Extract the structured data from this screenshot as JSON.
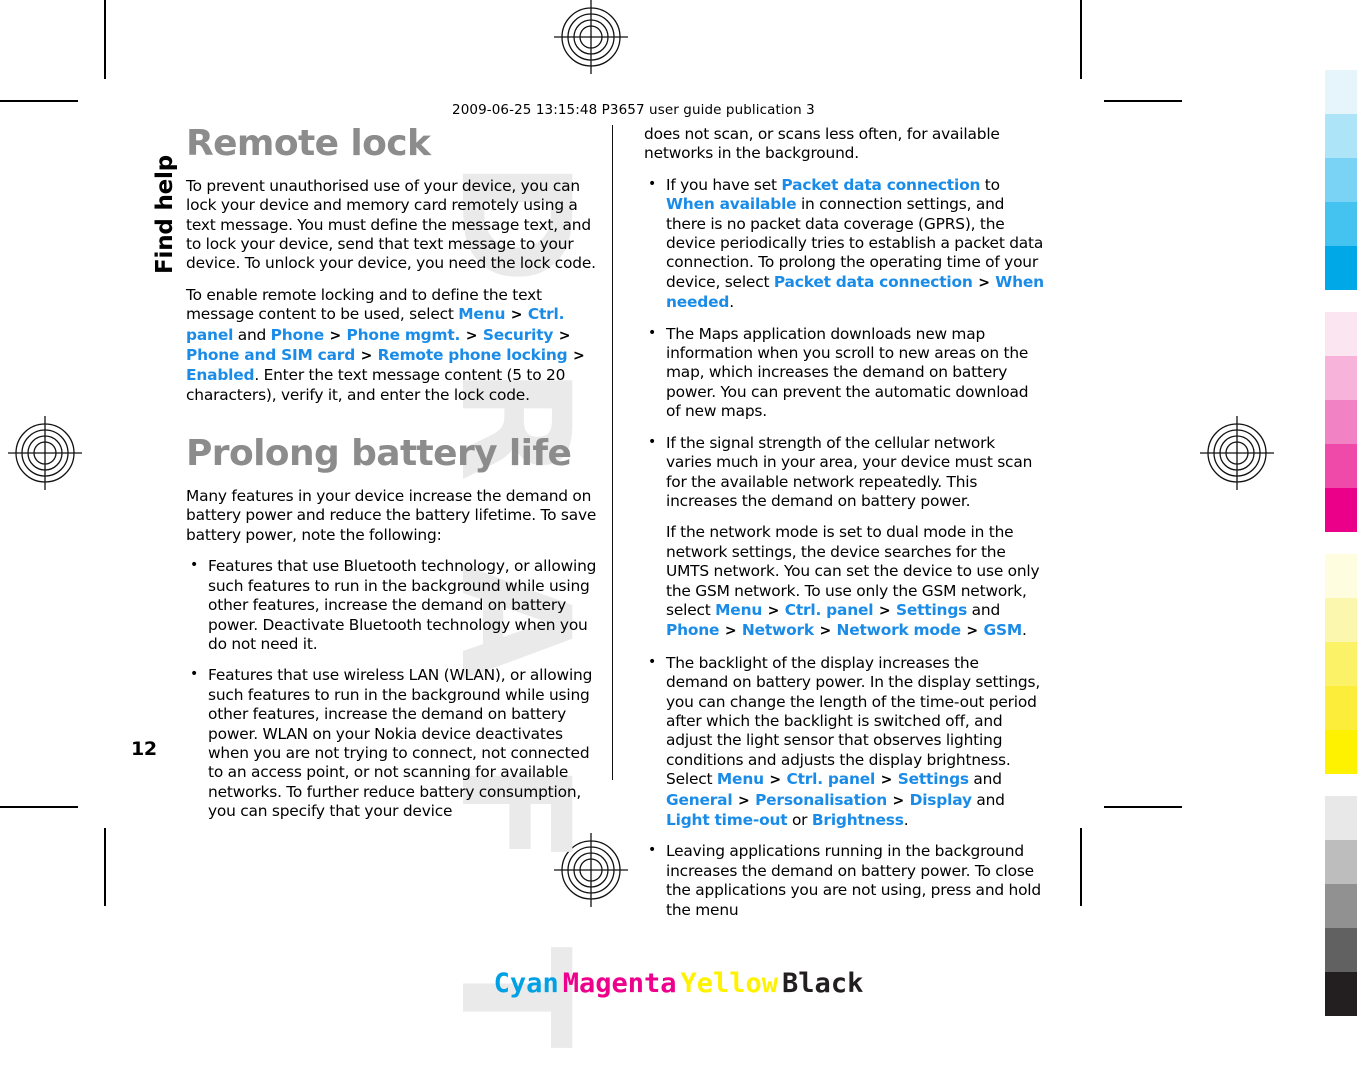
{
  "document": {
    "slug": "2009-06-25 13:15:48 P3657 user guide publication 3",
    "chapter_tab": "Find help",
    "page_number": "12",
    "watermark": "DRAFT"
  },
  "left_column": {
    "heading1": "Remote lock",
    "para1": "To prevent unauthorised use of your device, you can lock your device and memory card remotely using a text message. You must define the message text, and to lock your device, send that text message to your device. To unlock your device, you need the lock code.",
    "para2_pre": "To enable remote locking and to define the text message content to be used, select ",
    "para2_nav1": "Menu",
    "para2_nav2": "Ctrl. panel",
    "para2_mid1": " and ",
    "para2_nav3": "Phone",
    "para2_nav4": "Phone mgmt.",
    "para2_nav5": "Security",
    "para2_nav6": "Phone and SIM card",
    "para2_nav7": "Remote phone locking",
    "para2_nav8": "Enabled",
    "para2_post": ". Enter the text message content (5 to 20 characters), verify it, and enter the lock code.",
    "heading2": "Prolong battery life",
    "para3": "Many features in your device increase the demand on battery power and reduce the battery lifetime. To save battery power, note the following:",
    "bullet1": "Features that use Bluetooth technology, or allowing such features to run in the background while using other features, increase the demand on battery power. Deactivate Bluetooth technology when you do not need it.",
    "bullet2": "Features that use wireless LAN (WLAN), or allowing such features to run in the background while using other features, increase the demand on battery power. WLAN on your Nokia device deactivates when you are not trying to connect, not connected to an access point, or not scanning for available networks. To further reduce battery consumption, you can specify that your device"
  },
  "right_column": {
    "continuation": "does not scan, or scans less often, for available networks in the background.",
    "bullet1_pre": "If you have set ",
    "bullet1_nav1": "Packet data connection",
    "bullet1_mid1": " to ",
    "bullet1_nav2": "When available",
    "bullet1_mid2": " in connection settings, and there is no packet data coverage (GPRS), the device periodically tries to establish a packet data connection. To prolong the operating time of your device, select ",
    "bullet1_nav3": "Packet data connection",
    "bullet1_nav4": "When needed",
    "bullet1_post": ".",
    "bullet2": "The Maps application downloads new map information when you scroll to new areas on the map, which increases the demand on battery power. You can prevent the automatic download of new maps.",
    "bullet3": "If the signal strength of the cellular network varies much in your area, your device must scan for the available network repeatedly. This increases the demand on battery power.",
    "bullet4_pre": "If the network mode is set to dual mode in the network settings, the device searches for the UMTS network. You can set the device to use only the GSM network. To use only the GSM network, select ",
    "bullet4_nav1": "Menu",
    "bullet4_nav2": "Ctrl. panel",
    "bullet4_nav3": "Settings",
    "bullet4_mid1": " and ",
    "bullet4_nav4": "Phone",
    "bullet4_nav5": "Network",
    "bullet4_nav6": "Network mode",
    "bullet4_nav7": "GSM",
    "bullet4_post": ".",
    "bullet5_pre": "The backlight of the display increases the demand on battery power. In the display settings, you can change the length of the time-out period after which the backlight is switched off, and adjust the light sensor that observes lighting conditions and adjusts the display brightness. Select ",
    "bullet5_nav1": "Menu",
    "bullet5_nav2": "Ctrl. panel",
    "bullet5_nav3": "Settings",
    "bullet5_mid1": " and ",
    "bullet5_nav4": "General",
    "bullet5_nav5": "Personalisation",
    "bullet5_nav6": "Display",
    "bullet5_mid2": " and ",
    "bullet5_nav7": "Light time-out",
    "bullet5_mid3": " or ",
    "bullet5_nav8": "Brightness",
    "bullet5_post": ".",
    "bullet6": "Leaving applications running in the background increases the demand on battery power. To close the applications you are not using, press and hold the menu"
  },
  "separator": ">",
  "colors": {
    "nav_link": "#1a8ce8",
    "heading": "#8c8c8c",
    "watermark": "#eaeaea",
    "cyan": "#00a0e4",
    "magenta": "#ec008c",
    "yellow": "#fff200",
    "black": "#231f20"
  },
  "color_bar": [
    "#e6f4fc",
    "#ade4f8",
    "#7ad3f5",
    "#44c3f0",
    "#00a8e8",
    "gap",
    "#fae5f0",
    "#f7b3d9",
    "#f183c4",
    "#ef4aa9",
    "#eb0089",
    "gap",
    "#fffde0",
    "#fcf7ae",
    "#fcf267",
    "#fbed3a",
    "#fff200",
    "gap",
    "#e8e8e8",
    "#bdbdbd",
    "#919191",
    "#616161",
    "#231f20"
  ],
  "cmyk_footer": {
    "cyan": "Cyan",
    "magenta": "Magenta",
    "yellow": "Yellow",
    "black": "Black"
  }
}
